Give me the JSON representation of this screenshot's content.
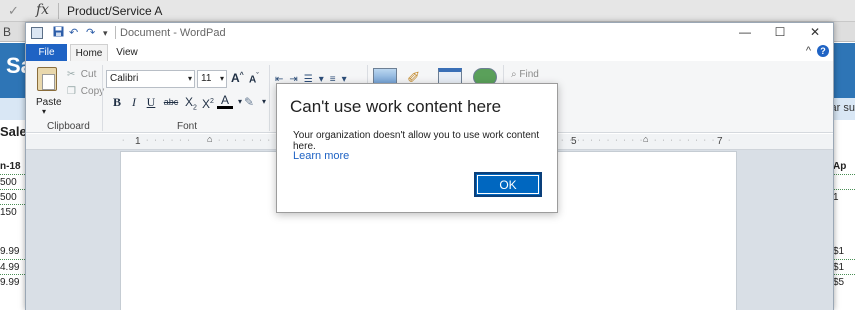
{
  "excel": {
    "formula_text": "Product/Service A",
    "fx_label": "fx",
    "check_glyph": "✓",
    "col_letter": "B",
    "title_fragment": "Sa",
    "right_fragment": "ar su",
    "sales_label": "Sales",
    "left_cells": [
      "n-18",
      "500",
      "500",
      "150",
      "9.99",
      "4.99",
      "9.99"
    ],
    "right_cells": [
      "Ap",
      "",
      "1",
      "",
      "$1",
      "$1",
      "$5"
    ]
  },
  "wordpad": {
    "title": "Document - WordPad",
    "window_controls": {
      "minimize": "—",
      "maximize": "☐",
      "close": "✕"
    },
    "tabs": [
      "File",
      "Home",
      "View"
    ],
    "ribbon": {
      "paste": "Paste",
      "cut": "Cut",
      "copy": "Copy",
      "font_name": "Calibri",
      "font_size": "11",
      "groups": {
        "clipboard": "Clipboard",
        "font": "Font"
      },
      "find": "Find"
    },
    "ruler": {
      "one": "1",
      "five": "5",
      "seven": "7"
    }
  },
  "dialog": {
    "title": "Can't use work content here",
    "message": "Your organization doesn't allow you to use work content here.",
    "link": "Learn more",
    "ok": "OK"
  },
  "colors": {
    "accent": "#1f63c4",
    "ok_button": "#0067c0",
    "excel_band": "#2e75b6"
  }
}
